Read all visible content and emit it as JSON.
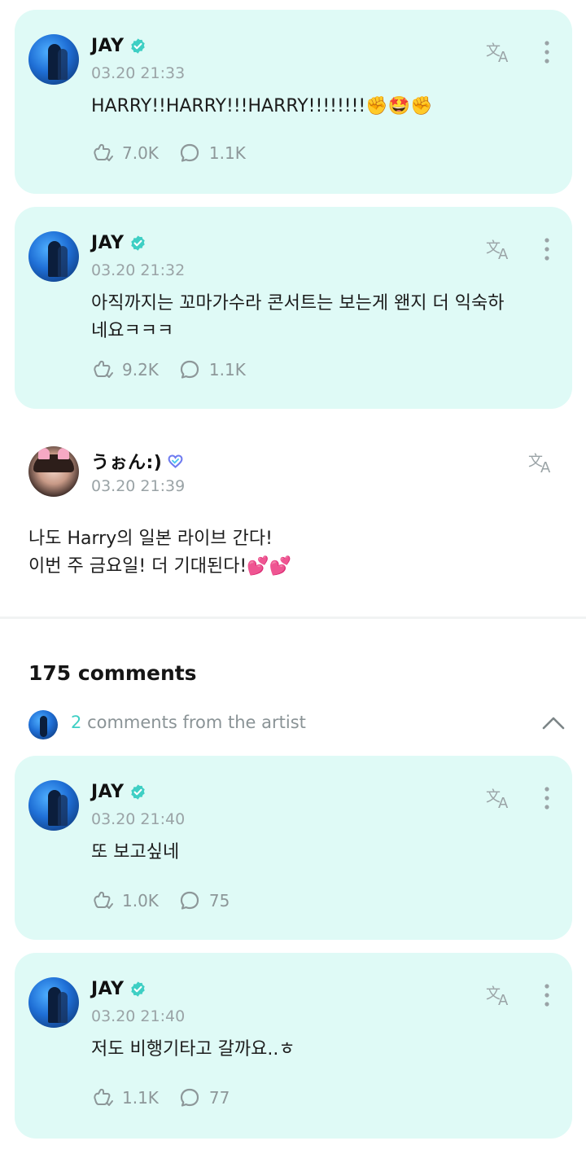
{
  "posts": [
    {
      "author": "JAY",
      "time": "03.20 21:33",
      "text": "HARRY!!HARRY!!!HARRY!!!!!!!!✊🤩✊",
      "likes": "7.0K",
      "comments": "1.1K"
    },
    {
      "author": "JAY",
      "time": "03.20 21:32",
      "text_line1": "아직까지는 꼬마가수라 콘서트는 보는게 왠지 더 익숙하",
      "text_line2": "네요ㅋㅋㅋ",
      "likes": "9.2K",
      "comments": "1.1K"
    }
  ],
  "fan_post": {
    "author": "うぉん:)",
    "time": "03.20 21:39",
    "line1": "나도 Harry의 일본 라이브 간다!",
    "line2": "이번 주 금요일! 더 기대된다!💕💕"
  },
  "comments_section": {
    "title": "175 comments",
    "artist_count": "2",
    "artist_label": "comments from the artist"
  },
  "artist_comments": [
    {
      "author": "JAY",
      "time": "03.20 21:40",
      "text": "또 보고싶네",
      "likes": "1.0K",
      "comments": "75"
    },
    {
      "author": "JAY",
      "time": "03.20 21:40",
      "text": "저도 비행기타고 갈까요..ㅎ",
      "likes": "1.1K",
      "comments": "77"
    }
  ],
  "colors": {
    "card_bg": "#dffaf6",
    "accent": "#3ecfc4",
    "muted": "#9aa3a6"
  },
  "icons": [
    "verified-icon",
    "translate-icon",
    "more-vertical-icon",
    "like-icon",
    "comment-icon",
    "chevron-up-icon",
    "heart-badge-icon"
  ]
}
